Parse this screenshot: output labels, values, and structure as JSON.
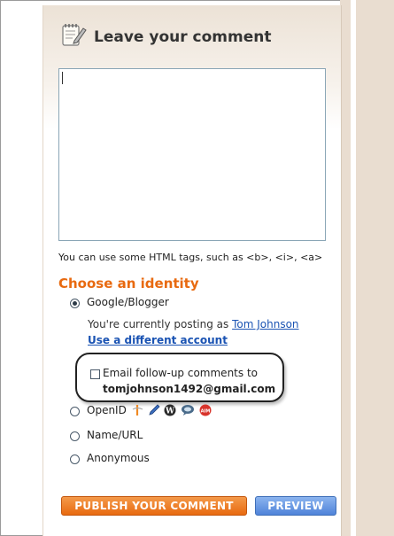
{
  "header": {
    "title": "Leave your comment",
    "icon": "notepad-pencil-icon"
  },
  "comment": {
    "value": ""
  },
  "hint": "You can use some HTML tags, such as <b>, <i>, <a>",
  "identity": {
    "heading": "Choose an identity",
    "options": [
      {
        "label": "Google/Blogger",
        "selected": true
      },
      {
        "label": "OpenID",
        "selected": false
      },
      {
        "label": "Name/URL",
        "selected": false
      },
      {
        "label": "Anonymous",
        "selected": false
      }
    ],
    "posting_prefix": "You're currently posting as",
    "user_name": "Tom Johnson",
    "different_account": "Use a different account",
    "follow_up": {
      "label": "Email follow-up comments to",
      "email": "tomjohnson1492@gmail.com",
      "checked": false
    },
    "openid_providers": [
      "openid-icon",
      "livejournal-icon",
      "wordpress-icon",
      "typepad-icon",
      "aim-icon"
    ]
  },
  "buttons": {
    "publish": "PUBLISH YOUR COMMENT",
    "preview": "PREVIEW"
  },
  "colors": {
    "heading_orange": "#e86a10",
    "link_blue": "#1a53b3",
    "publish_orange": "#e86a10",
    "preview_blue": "#4f83d9",
    "sidebar_tan": "#e9ddd0"
  }
}
